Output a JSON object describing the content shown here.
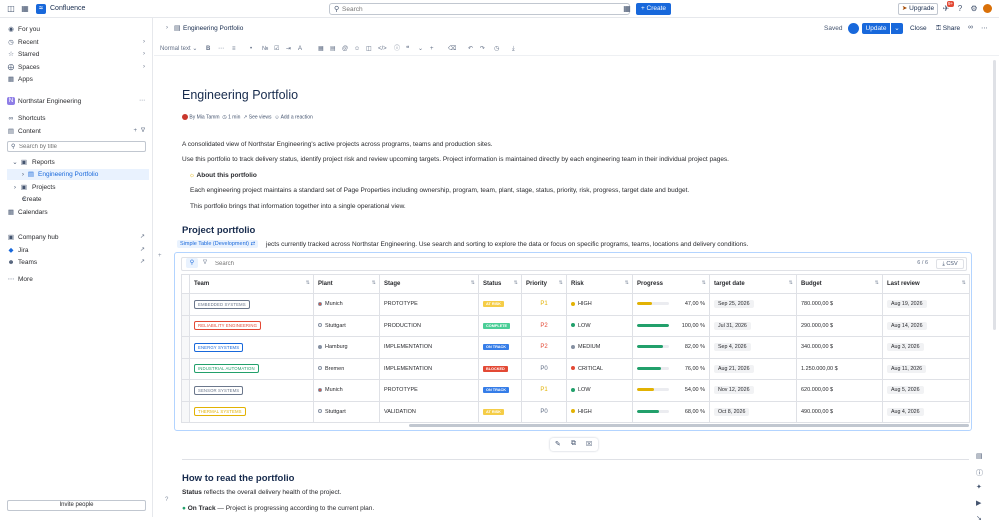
{
  "app": {
    "name": "Confluence"
  },
  "topbar": {
    "search_placeholder": "Search",
    "create_label": "+ Create",
    "upgrade_label": "Upgrade",
    "notif_count": "9+"
  },
  "sidebar": {
    "top_items": [
      {
        "label": "For you"
      },
      {
        "label": "Recent"
      },
      {
        "label": "Starred"
      },
      {
        "label": "Spaces"
      },
      {
        "label": "Apps"
      }
    ],
    "space_name": "Northstar Engineering",
    "shortcuts_label": "Shortcuts",
    "content_label": "Content",
    "filter_placeholder": "Search by title",
    "tree": [
      {
        "label": "Reports"
      },
      {
        "label": "Engineering Portfolio"
      },
      {
        "label": "Projects"
      },
      {
        "label": "Create"
      }
    ],
    "calendars_label": "Calendars",
    "apps": [
      {
        "label": "Company hub"
      },
      {
        "label": "Jira"
      },
      {
        "label": "Teams"
      }
    ],
    "more_label": "More",
    "invite_label": "Invite people"
  },
  "header": {
    "breadcrumb": "Engineering Portfolio",
    "saved": "Saved",
    "update": "Update",
    "close": "Close",
    "share": "Share"
  },
  "toolbar": {
    "text_style": "Normal text"
  },
  "page": {
    "title": "Engineering Portfolio",
    "author": "By Mia Tamm",
    "read_time": "1 min",
    "see_views": "See views",
    "add_reaction": "Add a reaction",
    "intro1": "A consolidated view of Northstar Engineering's active projects across programs, teams and production sites.",
    "intro2": "Use this portfolio to track delivery status, identify project risk and review upcoming targets. Project information is maintained directly by each engineering team in their individual project pages.",
    "panel_title": "About this portfolio",
    "panel_text1": "Each engineering project maintains a standard set of Page Properties including ownership, program, team, plant, stage, status, priority, risk, progress, target date and budget.",
    "panel_text2": "This portfolio brings that information together into a single operational view.",
    "section_title": "Project portfolio",
    "macro_label": "Simple Table (Development)",
    "section_text": "jects currently tracked across Northstar Engineering. Use search and sorting to explore the data or focus on specific programs, teams, locations and delivery conditions.",
    "how_title": "How to read the portfolio",
    "status_bold": "Status",
    "status_text": " reflects the overall delivery health of the project.",
    "ontrack_bold": "On Track",
    "ontrack_text": " — Project is progressing according to the current plan."
  },
  "table": {
    "search_placeholder": "Search",
    "count": "6 / 6",
    "csv_label": "CSV",
    "columns": [
      "Team",
      "Plant",
      "Stage",
      "Status",
      "Priority",
      "Risk",
      "Progress",
      "target date",
      "Budget",
      "Last review"
    ],
    "rows": [
      {
        "team": "EMBEDDED SYSTEMS",
        "team_color": "#6b778c",
        "plant": "Munich",
        "plant_dot": "#e34935",
        "stage": "PROTOTYPE",
        "status": "AT RISK",
        "status_color": "#f5cd47",
        "priority": "P1",
        "prio_color": "#e2b203",
        "risk": "HIGH",
        "risk_color": "#e2b203",
        "progress": 0.47,
        "progress_label": "47,00 %",
        "bar_color": "#e2b203",
        "target": "Sep 25, 2026",
        "budget": "780.000,00 $",
        "review": "Aug 19, 2026"
      },
      {
        "team": "RELIABILITY ENGINEERING",
        "team_color": "#e34935",
        "plant": "Stuttgart",
        "plant_dot": "#ffffff",
        "stage": "PRODUCTION",
        "status": "COMPLETE",
        "status_color": "#4bce97",
        "priority": "P2",
        "prio_color": "#e34935",
        "risk": "LOW",
        "risk_color": "#22a06b",
        "progress": 1.0,
        "progress_label": "100,00 %",
        "bar_color": "#22a06b",
        "target": "Jul 31, 2026",
        "budget": "290.000,00 $",
        "review": "Aug 14, 2026"
      },
      {
        "team": "ENERGY SYSTEMS",
        "team_color": "#1868db",
        "plant": "Hamburg",
        "plant_dot": "#8590a2",
        "stage": "IMPLEMENTATION",
        "status": "ON TRACK",
        "status_color": "#357de8",
        "priority": "P2",
        "prio_color": "#e34935",
        "risk": "MEDIUM",
        "risk_color": "#8590a2",
        "progress": 0.82,
        "progress_label": "82,00 %",
        "bar_color": "#22a06b",
        "target": "Sep 4, 2026",
        "budget": "340.000,00 $",
        "review": "Aug 3, 2026"
      },
      {
        "team": "INDUSTRIAL AUTOMATION",
        "team_color": "#22a06b",
        "plant": "Bremen",
        "plant_dot": "#ffffff",
        "stage": "IMPLEMENTATION",
        "status": "BLOCKED",
        "status_color": "#e34935",
        "priority": "P0",
        "prio_color": "#626f86",
        "risk": "CRITICAL",
        "risk_color": "#e34935",
        "progress": 0.76,
        "progress_label": "76,00 %",
        "bar_color": "#22a06b",
        "target": "Aug 21, 2026",
        "budget": "1.250.000,00 $",
        "review": "Aug 11, 2026"
      },
      {
        "team": "SENSOR SYSTEMS",
        "team_color": "#6b778c",
        "plant": "Munich",
        "plant_dot": "#e34935",
        "stage": "PROTOTYPE",
        "status": "ON TRACK",
        "status_color": "#357de8",
        "priority": "P1",
        "prio_color": "#e2b203",
        "risk": "LOW",
        "risk_color": "#22a06b",
        "progress": 0.54,
        "progress_label": "54,00 %",
        "bar_color": "#e2b203",
        "target": "Nov 12, 2026",
        "budget": "620.000,00 $",
        "review": "Aug 5, 2026"
      },
      {
        "team": "THERMAL SYSTEMS",
        "team_color": "#e2b203",
        "plant": "Stuttgart",
        "plant_dot": "#ffffff",
        "stage": "VALIDATION",
        "status": "AT RISK",
        "status_color": "#f5cd47",
        "priority": "P0",
        "prio_color": "#626f86",
        "risk": "HIGH",
        "risk_color": "#e2b203",
        "progress": 0.68,
        "progress_label": "68,00 %",
        "bar_color": "#22a06b",
        "target": "Oct 8, 2026",
        "budget": "490.000,00 $",
        "review": "Aug 4, 2026"
      }
    ]
  }
}
